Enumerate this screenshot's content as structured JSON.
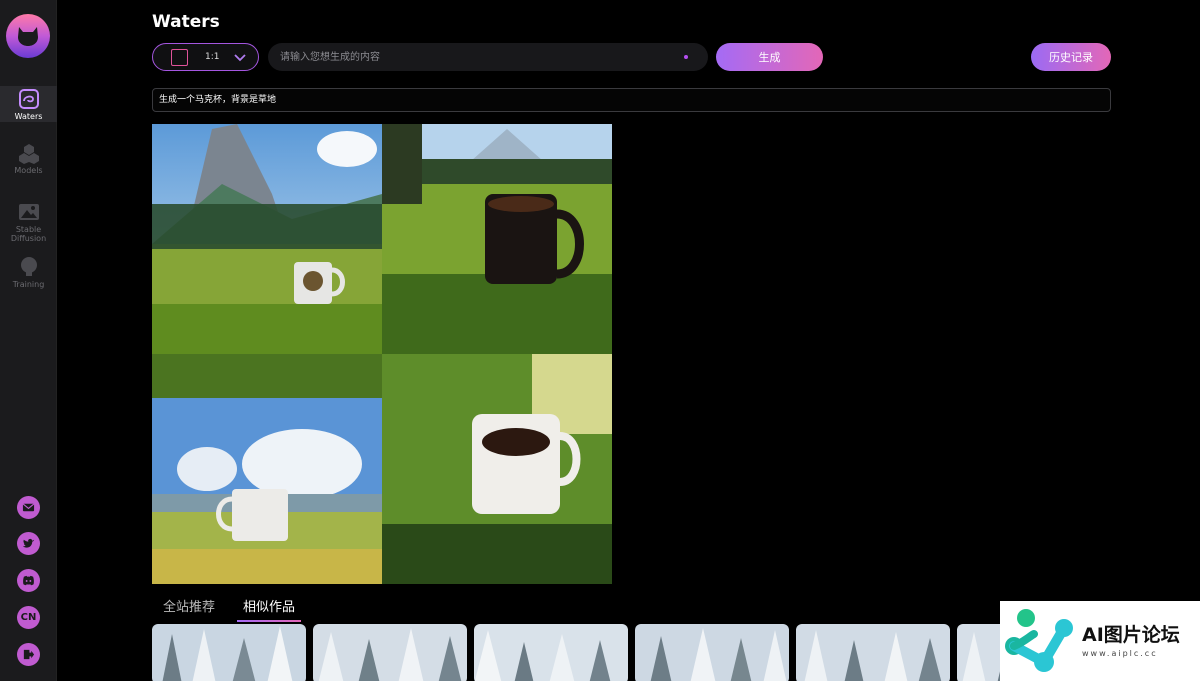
{
  "app": {
    "title": "Waters"
  },
  "sidebar": {
    "items": [
      {
        "label": "Waters",
        "icon": "waters-icon",
        "active": true
      },
      {
        "label": "Models",
        "icon": "models-icon",
        "active": false
      },
      {
        "label_line1": "Stable",
        "label_line2": "Diffusion",
        "icon": "image-icon",
        "active": false
      },
      {
        "label": "Training",
        "icon": "training-icon",
        "active": false
      }
    ],
    "social": [
      {
        "icon": "mail-icon"
      },
      {
        "icon": "twitter-icon"
      },
      {
        "icon": "discord-icon"
      },
      {
        "icon": "language-icon",
        "label": "CN"
      },
      {
        "icon": "logout-icon"
      }
    ]
  },
  "toolbar": {
    "ratio_label": "1:1",
    "prompt_placeholder": "请输入您想生成的内容",
    "generate_label": "生成",
    "history_label": "历史记录"
  },
  "prompt_display": "生成一个马克杯，背景是草地",
  "tabs": [
    {
      "label": "全站推荐",
      "active": false
    },
    {
      "label": "相似作品",
      "active": true
    }
  ],
  "watermark": {
    "main": "AI图片论坛",
    "sub": "www.aiplc.cc"
  },
  "colors": {
    "accent_purple": "#a46bf5",
    "accent_pink": "#e367b7",
    "sidebar_bg": "#1b1b1d"
  }
}
